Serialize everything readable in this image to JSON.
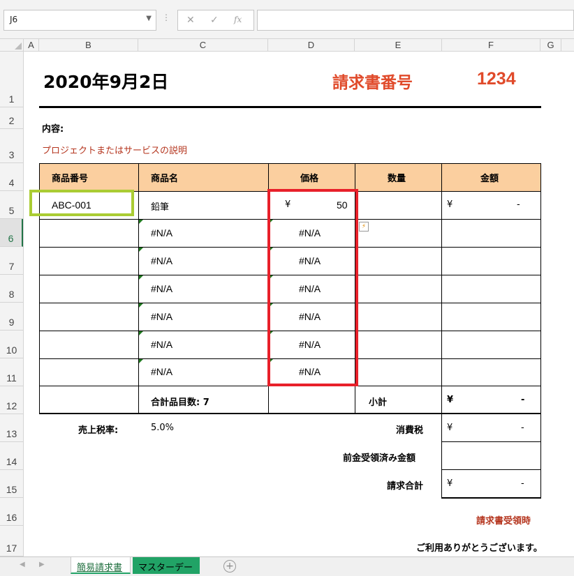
{
  "formula_bar": {
    "name_box": "J6",
    "cancel_glyph": "✕",
    "enter_glyph": "✓",
    "fx_glyph": "fx",
    "formula": ""
  },
  "columns": [
    "A",
    "B",
    "C",
    "D",
    "E",
    "F",
    "G"
  ],
  "rows": [
    "1",
    "2",
    "3",
    "4",
    "5",
    "6",
    "7",
    "8",
    "9",
    "10",
    "11",
    "12",
    "13",
    "14",
    "15",
    "16",
    "17"
  ],
  "invoice": {
    "date": "2020年9月2日",
    "number_label": "請求書番号",
    "number_value": "1234",
    "content_label": "内容:",
    "description": "プロジェクトまたはサービスの説明",
    "headers": {
      "code": "商品番号",
      "name": "商品名",
      "price": "価格",
      "qty": "数量",
      "amount": "金額"
    },
    "items": [
      {
        "code": "ABC-001",
        "name": "鉛筆",
        "price_yen": "¥",
        "price": "50",
        "amount_yen": "¥",
        "amount": "-"
      },
      {
        "code": "",
        "name": "#N/A",
        "price": "#N/A"
      },
      {
        "code": "",
        "name": "#N/A",
        "price": "#N/A"
      },
      {
        "code": "",
        "name": "#N/A",
        "price": "#N/A"
      },
      {
        "code": "",
        "name": "#N/A",
        "price": "#N/A"
      },
      {
        "code": "",
        "name": "#N/A",
        "price": "#N/A"
      },
      {
        "code": "",
        "name": "#N/A",
        "price": "#N/A"
      }
    ],
    "total_items_label": "合計品目数: 7",
    "subtotal_label": "小計",
    "subtotal_yen": "¥",
    "subtotal_value": "-",
    "tax_rate_label": "売上税率:",
    "tax_rate_value": "5.0%",
    "tax_label": "消費税",
    "tax_yen": "¥",
    "tax_value": "-",
    "prepaid_label": "前金受領済み金額",
    "total_label": "請求合計",
    "total_yen": "¥",
    "total_value": "-",
    "receipt_note": "請求書受領時",
    "thanks": "ご利用ありがとうございます。"
  },
  "sheets": {
    "tabs": [
      {
        "label": "簡易請求書",
        "active": true
      },
      {
        "label": "マスターデータ",
        "active": false
      }
    ],
    "add_glyph": "+"
  },
  "colors": {
    "header_fill": "#fbcf9f",
    "accent_red": "#e04a2a",
    "dark_red": "#b5361f",
    "highlight_red_box": "#e8202a",
    "highlight_green_box": "#aacc33",
    "sheet_green": "#21a366"
  }
}
